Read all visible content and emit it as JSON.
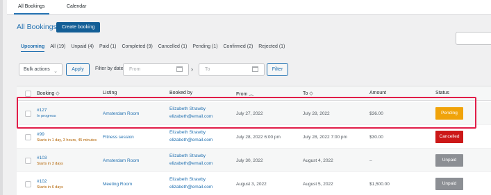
{
  "top_tabs": [
    "All Bookings",
    "Calendar"
  ],
  "page_title": "All Bookings",
  "create_button": "Create booking",
  "status_filters": [
    "Upcoming",
    "All (19)",
    "Unpaid (4)",
    "Paid (1)",
    "Completed (9)",
    "Cancelled (1)",
    "Pending (1)",
    "Confirmed (2)",
    "Rejected (1)"
  ],
  "bulk_actions": "Bulk actions",
  "apply": "Apply",
  "filter_by_date": "Filter by date",
  "from_placeholder": "From",
  "to_placeholder": "To",
  "filter_button": "Filter",
  "columns": {
    "booking": "Booking",
    "listing": "Listing",
    "booked_by": "Booked by",
    "from": "From",
    "to": "To",
    "amount": "Amount",
    "status": "Status"
  },
  "rows": [
    {
      "id": "#127",
      "note": "In progress",
      "listing": "Amsterdam Room",
      "name": "Elizabeth Strawby",
      "email": "elizabeth@email.com",
      "from": "July 27, 2022",
      "to": "July 28, 2022",
      "amount": "$36.00",
      "status": "Pending",
      "status_color": "#f0a30a"
    },
    {
      "id": "#99",
      "note": "Starts in 1 day, 3 hours, 45 minutes",
      "listing": "Fitness session",
      "name": "Elizabeth Strawby",
      "email": "elizabeth@email.com",
      "from": "July 28, 2022 6:00 pm",
      "to": "July 28, 2022 7:00 pm",
      "amount": "$30.00",
      "status": "Cancelled",
      "status_color": "#cc1818"
    },
    {
      "id": "#103",
      "note": "Starts in 3 days",
      "listing": "Amsterdam Room",
      "name": "Elizabeth Strawby",
      "email": "elizabeth@email.com",
      "from": "July 30, 2022",
      "to": "August 4, 2022",
      "amount": "–",
      "status": "Unpaid",
      "status_color": "#8c8f94"
    },
    {
      "id": "#102",
      "note": "Starts in 6 days",
      "listing": "Meeting Room",
      "name": "Elizabeth Strawby",
      "email": "elizabeth@email.com",
      "from": "August 3, 2022",
      "to": "August 5, 2022",
      "amount": "$1,500.00",
      "status": "Unpaid",
      "status_color": "#8c8f94"
    }
  ]
}
